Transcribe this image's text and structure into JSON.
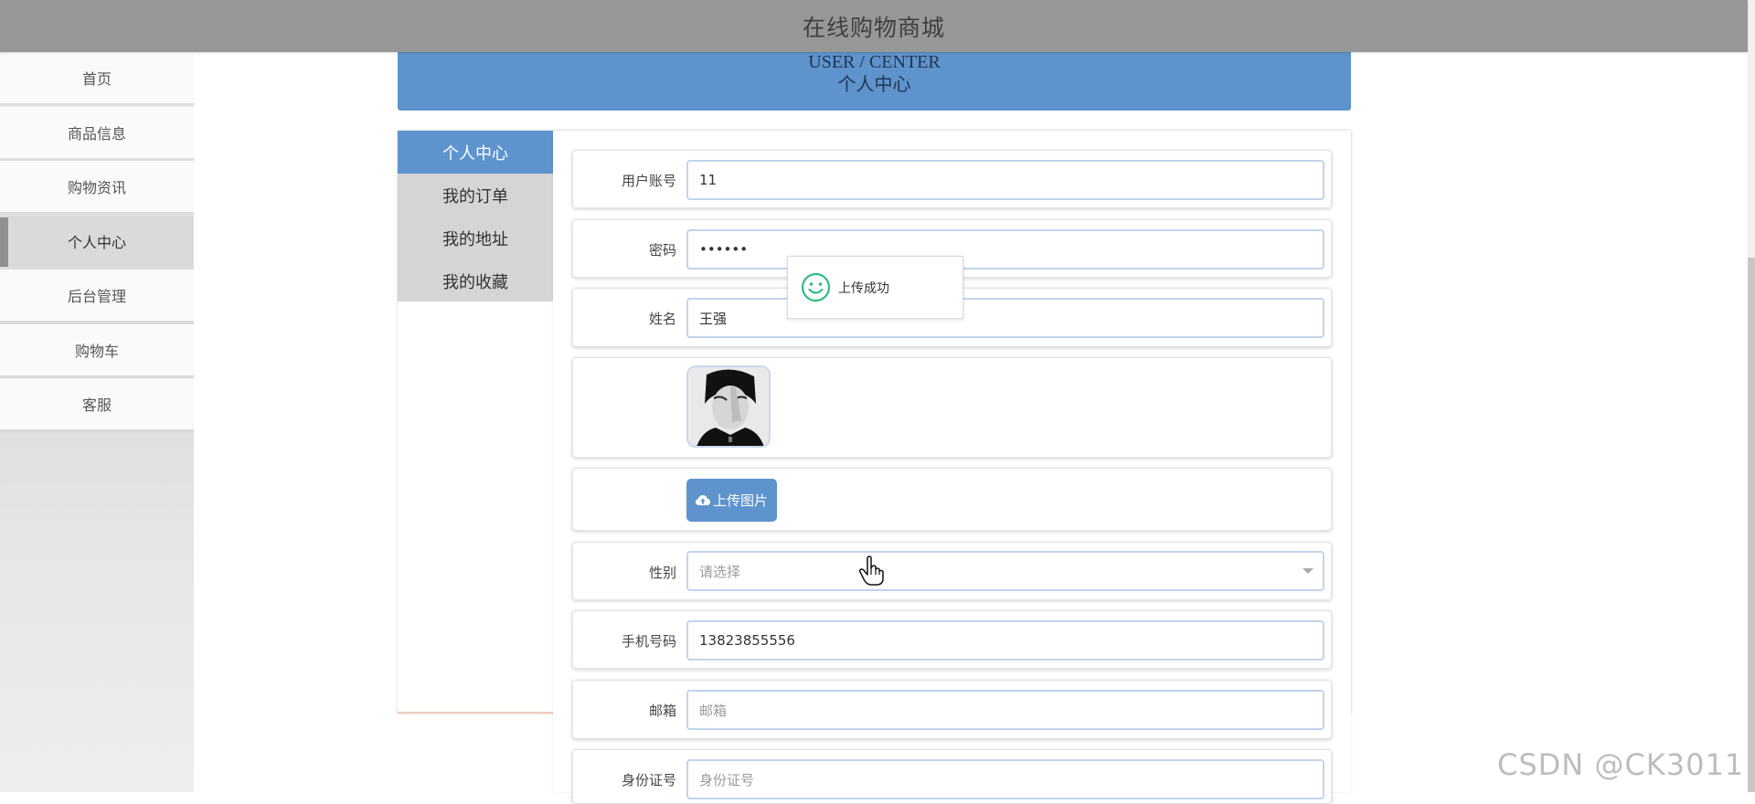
{
  "header": {
    "title": "在线购物商城"
  },
  "sidebar": {
    "items": [
      {
        "label": "首页"
      },
      {
        "label": "商品信息"
      },
      {
        "label": "购物资讯"
      },
      {
        "label": "个人中心"
      },
      {
        "label": "后台管理"
      },
      {
        "label": "购物车"
      },
      {
        "label": "客服"
      }
    ],
    "active": "个人中心"
  },
  "banner": {
    "en": "USER / CENTER",
    "cn": "个人中心"
  },
  "subnav": {
    "items": [
      {
        "label": "个人中心"
      },
      {
        "label": "我的订单"
      },
      {
        "label": "我的地址"
      },
      {
        "label": "我的收藏"
      }
    ],
    "active": "个人中心"
  },
  "form": {
    "account": {
      "label": "用户账号",
      "value": "11"
    },
    "password": {
      "label": "密码",
      "value": "••••••"
    },
    "name": {
      "label": "姓名",
      "value": "王强"
    },
    "upload": {
      "label": "上传图片",
      "icon": "cloud-upload-icon"
    },
    "gender": {
      "label": "性别",
      "placeholder": "请选择"
    },
    "phone": {
      "label": "手机号码",
      "value": "13823855556"
    },
    "email": {
      "label": "邮箱",
      "placeholder": "邮箱"
    },
    "idcard": {
      "label": "身份证号",
      "placeholder": "身份证号"
    }
  },
  "toast": {
    "message": "上传成功",
    "icon": "smile-icon"
  },
  "watermark": "CSDN @CK3011",
  "colors": {
    "accent": "#5e93cd",
    "topbar": "#959897",
    "success": "#2fbd82"
  }
}
